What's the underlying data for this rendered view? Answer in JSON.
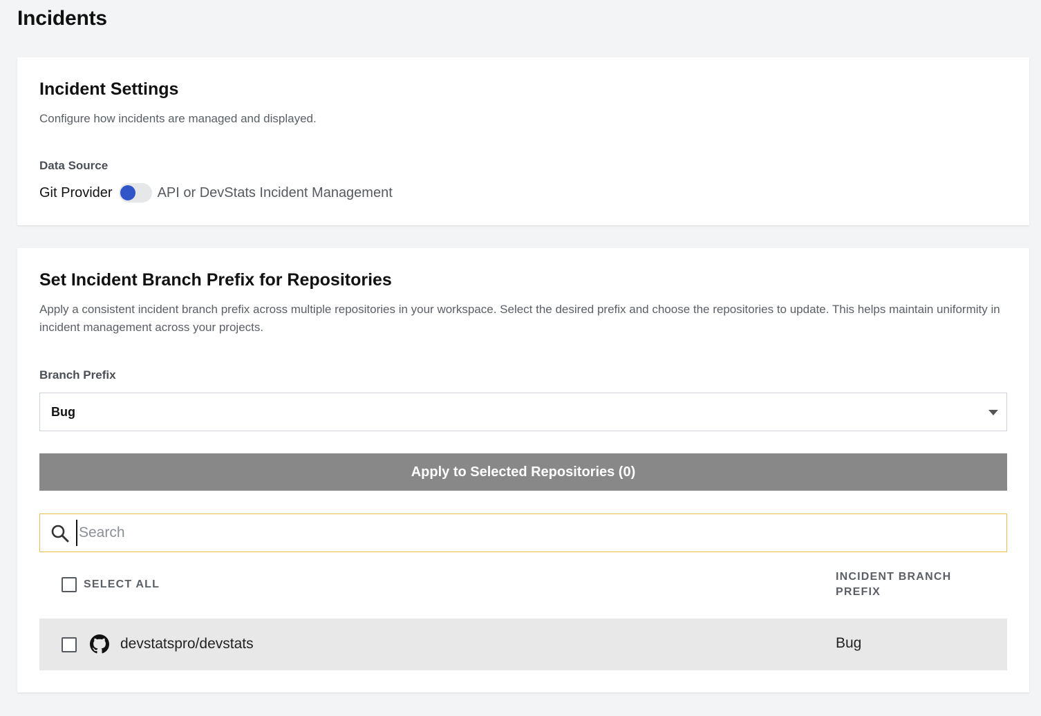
{
  "page": {
    "title": "Incidents"
  },
  "incident_settings": {
    "title": "Incident Settings",
    "description": "Configure how incidents are managed and displayed.",
    "data_source": {
      "label": "Data Source",
      "option_left": "Git Provider",
      "option_right": "API or DevStats Incident Management",
      "selected": "Git Provider"
    }
  },
  "branch_prefix_section": {
    "title": "Set Incident Branch Prefix for Repositories",
    "description": "Apply a consistent incident branch prefix across multiple repositories in your workspace. Select the desired prefix and choose the repositories to update. This helps maintain uniformity in incident management across your projects.",
    "branch_prefix_label": "Branch Prefix",
    "branch_prefix_value": "Bug",
    "apply_button_label": "Apply to Selected Repositories (0)",
    "search": {
      "placeholder": "Search",
      "value": ""
    },
    "table": {
      "select_all_label": "SELECT ALL",
      "prefix_column_header": "INCIDENT BRANCH PREFIX",
      "rows": [
        {
          "repo": "devstatspro/devstats",
          "prefix": "Bug",
          "icon": "github-icon",
          "checked": false
        }
      ]
    }
  },
  "colors": {
    "toggle_knob": "#2f55c9",
    "apply_button_bg": "#888888",
    "search_border": "#e4c04a",
    "row_bg": "#e8e8e9",
    "page_bg": "#f3f4f5"
  }
}
